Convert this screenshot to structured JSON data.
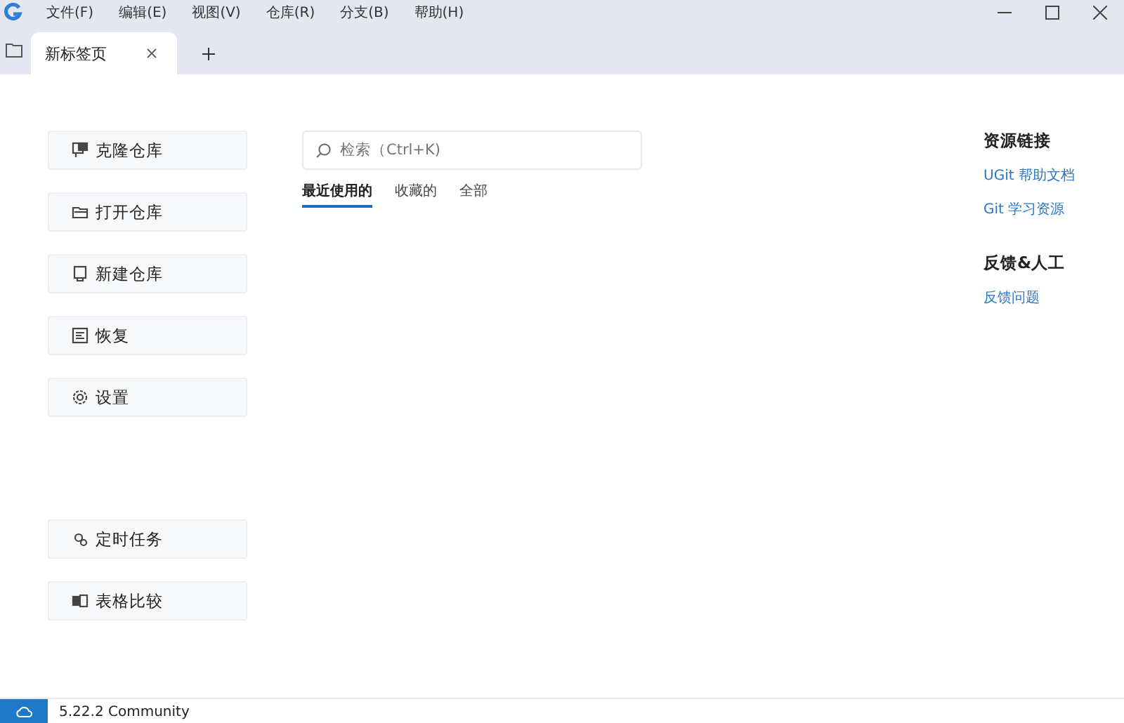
{
  "menu": [
    "文件(F)",
    "编辑(E)",
    "视图(V)",
    "仓库(R)",
    "分支(B)",
    "帮助(H)"
  ],
  "tabs": [
    {
      "label": "新标签页",
      "selected": true
    }
  ],
  "actions": [
    "克隆仓库",
    "打开仓库",
    "新建仓库",
    "恢复",
    "设置"
  ],
  "tools": [
    "定时任务",
    "表格比较"
  ],
  "search": {
    "placeholder": "检索（Ctrl+K)"
  },
  "repo_tabs": [
    {
      "label": "最近使用的",
      "selected": true
    },
    {
      "label": "收藏的",
      "selected": false
    },
    {
      "label": "全部",
      "selected": false
    }
  ],
  "resources": {
    "title": "资源链接",
    "links": [
      "UGit 帮助文档",
      "Git 学习资源"
    ]
  },
  "feedback": {
    "title": "反馈&人工",
    "links": [
      "反馈问题"
    ]
  },
  "status_bar": {
    "version": "5.22.2 Community"
  }
}
